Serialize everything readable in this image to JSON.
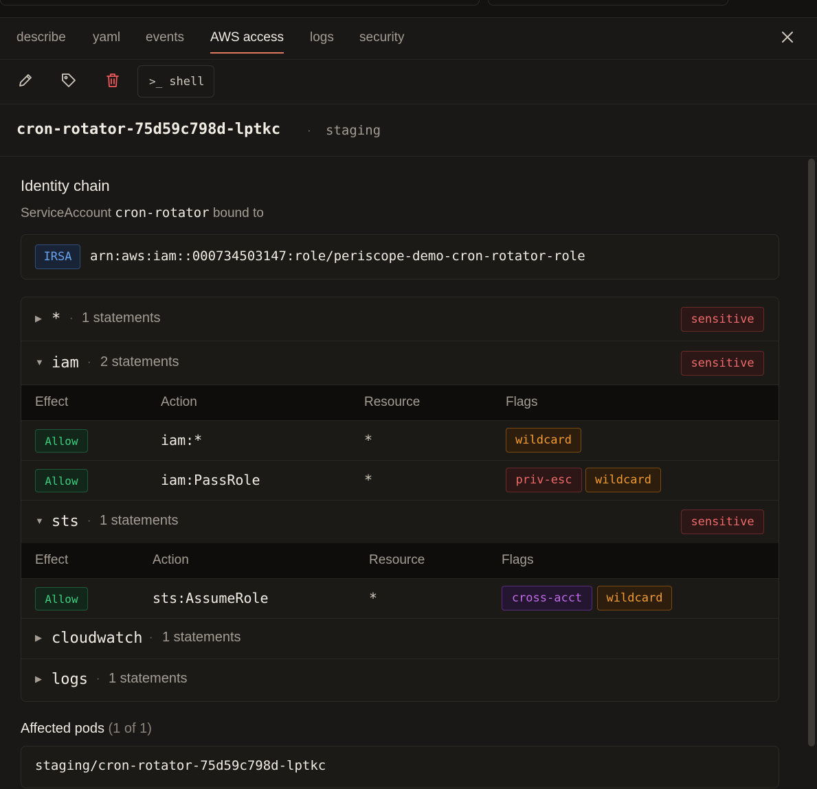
{
  "tabs": [
    {
      "label": "describe"
    },
    {
      "label": "yaml"
    },
    {
      "label": "events"
    },
    {
      "label": "AWS access",
      "active": true
    },
    {
      "label": "logs"
    },
    {
      "label": "security"
    }
  ],
  "toolbar": {
    "shell_label": "shell",
    "shell_prompt": ">_"
  },
  "header": {
    "pod_name": "cron-rotator-75d59c798d-lptkc",
    "separator": "·",
    "namespace": "staging"
  },
  "identity": {
    "title": "Identity chain",
    "sub_prefix": "ServiceAccount",
    "service_account": "cron-rotator",
    "sub_suffix": "bound to",
    "badge": "IRSA",
    "arn": "arn:aws:iam::000734503147:role/periscope-demo-cron-rotator-role"
  },
  "groups": [
    {
      "name": "*",
      "count": "1 statements",
      "expanded": false,
      "sensitive": "sensitive"
    },
    {
      "name": "iam",
      "count": "2 statements",
      "expanded": true,
      "sensitive": "sensitive"
    },
    {
      "name": "sts",
      "count": "1 statements",
      "expanded": true,
      "sensitive": "sensitive"
    },
    {
      "name": "cloudwatch",
      "count": "1 statements",
      "expanded": false
    },
    {
      "name": "logs",
      "count": "1 statements",
      "expanded": false
    }
  ],
  "table_headers": {
    "effect": "Effect",
    "action": "Action",
    "resource": "Resource",
    "flags": "Flags"
  },
  "iam_rows": [
    {
      "effect": "Allow",
      "action": "iam:*",
      "resource": "*",
      "flags": [
        "wildcard"
      ]
    },
    {
      "effect": "Allow",
      "action": "iam:PassRole",
      "resource": "*",
      "flags": [
        "priv-esc",
        "wildcard"
      ]
    }
  ],
  "sts_rows": [
    {
      "effect": "Allow",
      "action": "sts:AssumeRole",
      "resource": "*",
      "flags": [
        "cross-acct",
        "wildcard"
      ]
    }
  ],
  "affected": {
    "title": "Affected pods",
    "count": "(1 of 1)",
    "pods": [
      "staging/cron-rotator-75d59c798d-lptkc"
    ]
  },
  "colors": {
    "accent": "#e07a5f",
    "allow": "#3ccf7f",
    "wildcard": "#f39c32",
    "priv_esc": "#ef6b6b",
    "cross_acct": "#c06be8",
    "irsa": "#6aa3ef"
  }
}
